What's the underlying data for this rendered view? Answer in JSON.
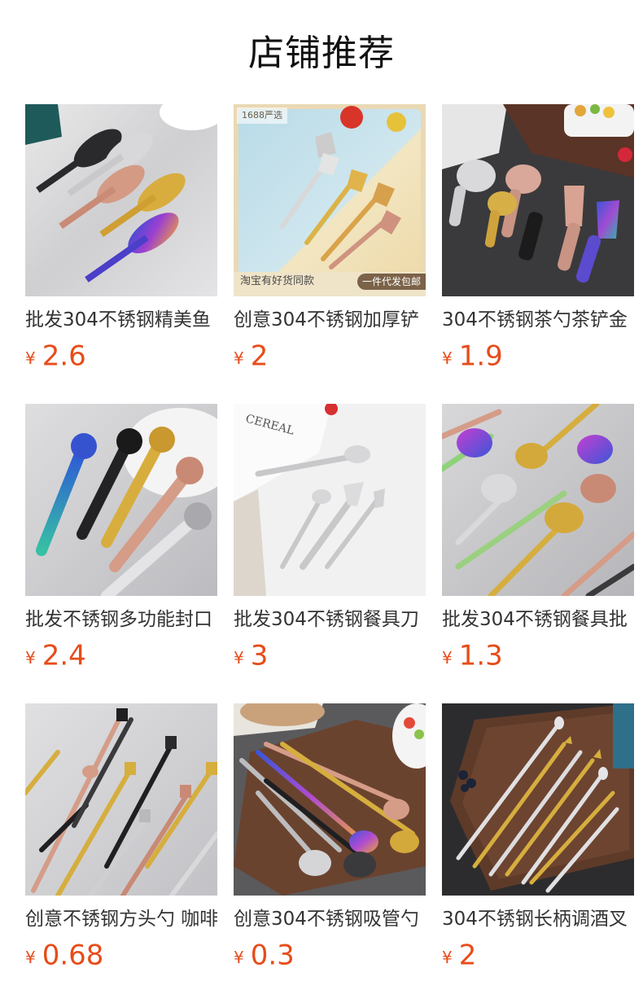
{
  "page": {
    "title": "店铺推荐"
  },
  "accent_color": "#e74c1a",
  "currency_symbol": "¥",
  "products": [
    {
      "name": "批发304不锈钢精美鱼",
      "price": "2.6",
      "image": "fish-spoons-image"
    },
    {
      "name": "创意304不锈钢加厚铲",
      "price": "2",
      "image": "shovel-spoons-image",
      "badge_top": "1688严选",
      "badge_left": "淘宝有好货同款",
      "badge_right": "一件代发包邮"
    },
    {
      "name": "304不锈钢茶勺茶铲金",
      "price": "1.9",
      "image": "tea-spoons-image"
    },
    {
      "name": "批发不锈钢多功能封口",
      "price": "2.4",
      "image": "coffee-scoops-image"
    },
    {
      "name": "批发304不锈钢餐具刀",
      "price": "3",
      "image": "cutlery-set-image"
    },
    {
      "name": "批发304不锈钢餐具批",
      "price": "1.3",
      "image": "long-spoons-image"
    },
    {
      "name": "创意不锈钢方头勺 咖啡",
      "price": "0.68",
      "image": "square-spoons-image"
    },
    {
      "name": "创意304不锈钢吸管勺",
      "price": "0.3",
      "image": "straw-spoons-image"
    },
    {
      "name": "304不锈钢长柄调酒叉",
      "price": "2",
      "image": "cocktail-forks-image"
    }
  ]
}
